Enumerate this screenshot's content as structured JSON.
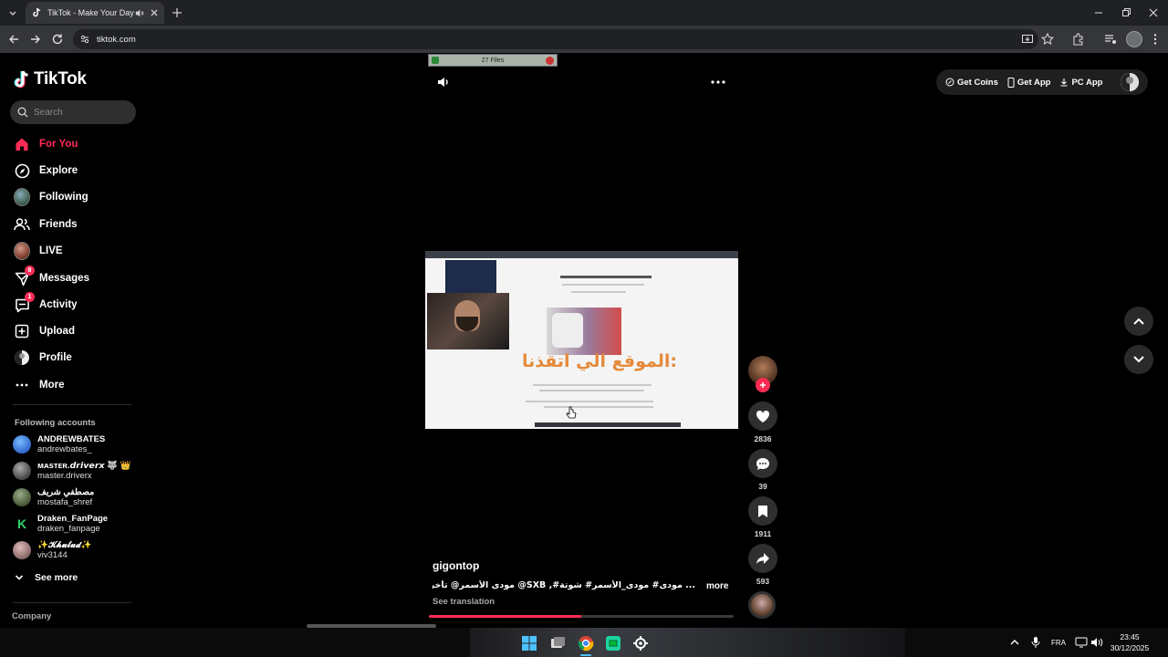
{
  "browser": {
    "tab_title": "TikTok - Make Your Day",
    "url": "tiktok.com"
  },
  "sidebar": {
    "brand": "TikTok",
    "search_placeholder": "Search",
    "nav": [
      {
        "label": "For You",
        "icon": "home-icon",
        "active": true
      },
      {
        "label": "Explore",
        "icon": "compass-icon"
      },
      {
        "label": "Following",
        "icon": "following-avatar"
      },
      {
        "label": "Friends",
        "icon": "friends-icon"
      },
      {
        "label": "LIVE",
        "icon": "live-avatar"
      },
      {
        "label": "Messages",
        "icon": "messages-icon",
        "badge": "8"
      },
      {
        "label": "Activity",
        "icon": "activity-icon",
        "badge": "1"
      },
      {
        "label": "Upload",
        "icon": "upload-icon"
      },
      {
        "label": "Profile",
        "icon": "profile-icon"
      },
      {
        "label": "More",
        "icon": "more-icon"
      }
    ],
    "following_title": "Following accounts",
    "accounts": [
      {
        "name": "ANDREWBATES",
        "user": "andrewbates_"
      },
      {
        "name": "ᴍᴀsᴛᴇʀ.𝙙𝙧𝙞𝙫𝙚𝙧𝙭 🐺 👑",
        "user": "master.driverx"
      },
      {
        "name": "مصطفي شريف",
        "user": "mostafa_shref"
      },
      {
        "name": "Draken_FanPage",
        "user": "draken_fanpage"
      },
      {
        "name": "✨𝓚𝓱𝓾𝓵𝓾𝓭✨",
        "user": "viv3144"
      }
    ],
    "see_more": "See more",
    "company": "Company"
  },
  "topbar": {
    "get_coins": "Get Coins",
    "get_app": "Get App",
    "pc_app": "PC App"
  },
  "overlay": {
    "files_label": "27 Files"
  },
  "video": {
    "frame_heading": "الموقع الي اتقذنا:",
    "author": "gigontop",
    "caption": "... مودى#  مودى_الأسمر#  شوتة#, SXB@  مودى الأسمر@ تأخر بس, عواقب",
    "more": "more",
    "see_translation": "See translation",
    "progress": 0.5,
    "likes": "2836",
    "comments": "39",
    "saves": "1911",
    "shares": "593"
  },
  "taskbar": {
    "lang": "FRA",
    "time": "23:45",
    "date": "30/12/2025"
  },
  "colors": {
    "accent": "#fe2c55",
    "background": "#000000",
    "chrome_dark": "#202124"
  }
}
